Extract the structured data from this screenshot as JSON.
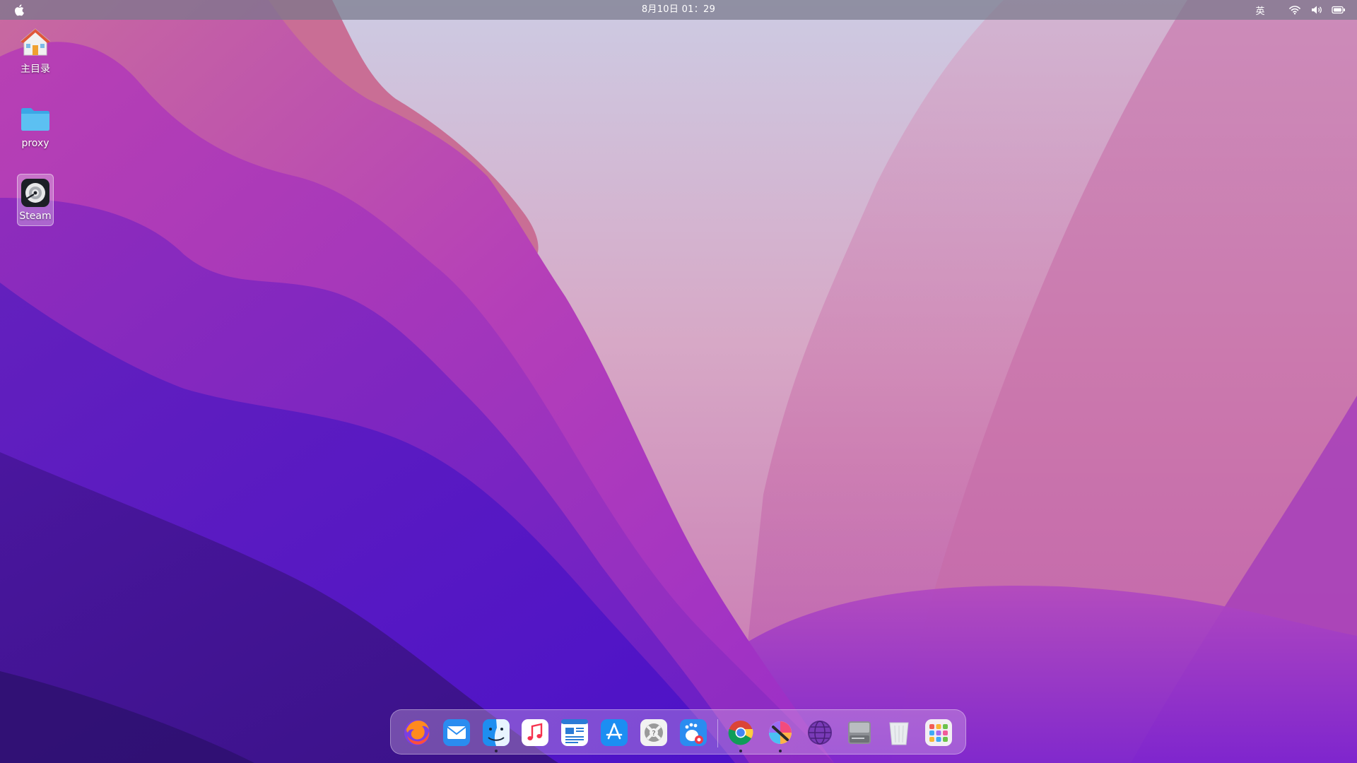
{
  "menubar": {
    "clock": "8月10日  01：29",
    "input_method": "英",
    "apple_icon": "apple-icon",
    "tray_icons": [
      "wifi-icon",
      "volume-icon",
      "battery-icon"
    ]
  },
  "desktop_icons": [
    {
      "label": "主目录",
      "icon": "home-folder-icon"
    },
    {
      "label": "proxy",
      "icon": "folder-icon"
    },
    {
      "label": "Steam",
      "icon": "steam-icon"
    }
  ],
  "dock": {
    "items": [
      {
        "name": "firefox",
        "icon": "firefox-icon"
      },
      {
        "name": "mail",
        "icon": "mail-icon"
      },
      {
        "name": "finder",
        "icon": "finder-icon"
      },
      {
        "name": "music",
        "icon": "music-icon"
      },
      {
        "name": "text-editor",
        "icon": "document-editor-icon"
      },
      {
        "name": "app-store",
        "icon": "app-store-icon"
      },
      {
        "name": "help",
        "icon": "help-lifebuoy-icon"
      },
      {
        "name": "gnome-tweaks",
        "icon": "gnome-foot-icon"
      },
      {
        "name": "chrome",
        "icon": "chrome-icon"
      },
      {
        "name": "color-picker",
        "icon": "color-picker-icon"
      },
      {
        "name": "network",
        "icon": "network-globe-icon"
      },
      {
        "name": "drive",
        "icon": "hard-drive-icon"
      },
      {
        "name": "trash",
        "icon": "trash-icon"
      },
      {
        "name": "app-grid",
        "icon": "app-grid-icon"
      }
    ],
    "running": [
      "finder",
      "chrome",
      "color-picker"
    ]
  },
  "colors": {
    "menubar_bg": "#78788a",
    "wallpaper_sky": "#d8c8e6",
    "wallpaper_pink": "#c34fb0",
    "wallpaper_violet": "#5a1fc4",
    "wallpaper_deep": "#3a1a8c"
  }
}
